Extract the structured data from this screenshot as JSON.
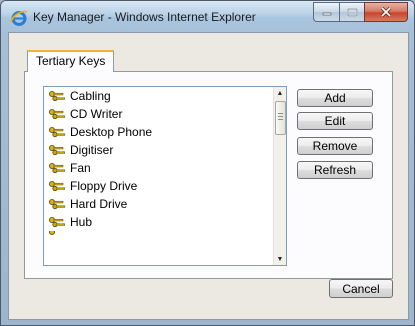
{
  "window": {
    "title": "Key Manager - Windows Internet Explorer"
  },
  "tabs": [
    {
      "label": "Tertiary Keys"
    }
  ],
  "list": {
    "items": [
      {
        "label": "Cabling"
      },
      {
        "label": "CD Writer"
      },
      {
        "label": "Desktop Phone"
      },
      {
        "label": "Digitiser"
      },
      {
        "label": "Fan"
      },
      {
        "label": "Floppy Drive"
      },
      {
        "label": "Hard Drive"
      },
      {
        "label": "Hub"
      }
    ]
  },
  "actions": {
    "add_label": "Add",
    "edit_label": "Edit",
    "remove_label": "Remove",
    "refresh_label": "Refresh"
  },
  "footer": {
    "cancel_label": "Cancel"
  },
  "colors": {
    "tab_highlight": "#f3b336",
    "key_icon": "#d4b21d",
    "ie_icon": "#2a7fd4"
  },
  "icons": {
    "app": "ie-icon",
    "list_item": "key-icon"
  }
}
